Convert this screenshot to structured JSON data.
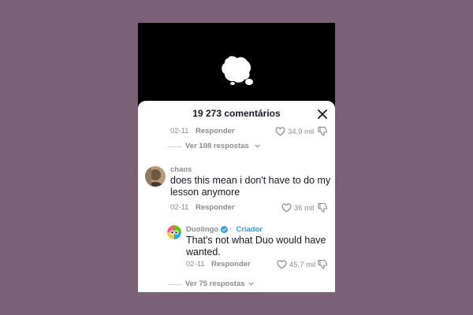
{
  "sheet": {
    "title": "19 273 comentários"
  },
  "comment_top": {
    "date": "02-11",
    "reply_label": "Responder",
    "likes": "34,9 mil"
  },
  "replies_top": {
    "label": "Ver 108 respostas"
  },
  "comment_chaos": {
    "username": "chaos",
    "text": "does this mean i don't have to do my lesson anymore",
    "date": "02-11",
    "reply_label": "Responder",
    "likes": "36 mil"
  },
  "reply_duolingo": {
    "username": "Duolingo",
    "separator": "·",
    "badge": "Criador",
    "text": "That's not what Duo would have wanted.",
    "date": "02-11",
    "reply_label": "Responder",
    "likes": "45,7 mil"
  },
  "replies_bottom": {
    "label": "Ver 75 respostas"
  },
  "colors": {
    "background": "#7a6178",
    "verified": "#2f9ee8",
    "muted_text": "#8a8b91",
    "primary_text": "#161823"
  },
  "icons": {
    "video": "duo-owl-silhouette-icon",
    "close": "close-icon",
    "like": "heart-outline-icon",
    "dislike": "dislike-thumb-icon",
    "verified": "verified-check-icon",
    "expand": "chevron-down-icon"
  }
}
